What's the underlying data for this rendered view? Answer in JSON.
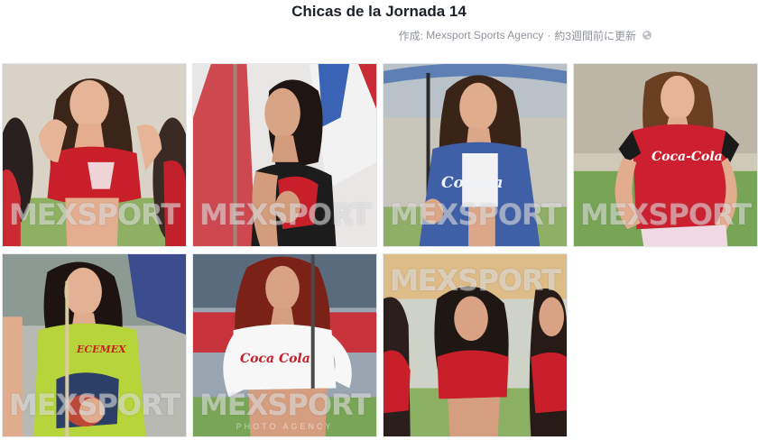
{
  "album": {
    "title": "Chicas de la Jornada 14",
    "created_prefix": "作成:",
    "author": "Mexsport Sports Agency",
    "separator": "·",
    "updated": "約3週間前に更新",
    "privacy_icon": "globe-icon"
  },
  "watermark": {
    "main": "MEXSPORT",
    "sub": "PHOTO AGENCY"
  },
  "shirt_prints": {
    "corona": "Corona",
    "coca_cola": "Coca-Cola",
    "coca_cola_alt": "Coca Cola",
    "sponsor": "ECEMEX"
  },
  "colors": {
    "title": "#1d2129",
    "meta": "#90949c",
    "grass": "#6fa84a",
    "red_top": "#d0202c",
    "blue_jacket": "#3b5da8",
    "lime_shirt": "#b7d43a"
  }
}
